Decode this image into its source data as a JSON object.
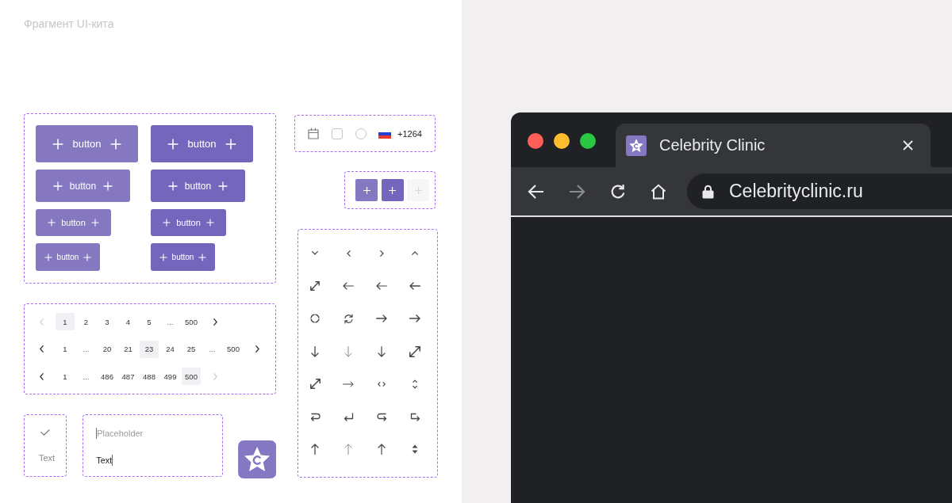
{
  "title": "Фрагмент UI-кита",
  "button_rows": [
    {
      "buttons": [
        {
          "label": "button",
          "kind": "light"
        },
        {
          "label": "button",
          "kind": "dark"
        }
      ]
    },
    {
      "buttons": [
        {
          "label": "button",
          "kind": "light"
        },
        {
          "label": "button",
          "kind": "dark"
        }
      ]
    },
    {
      "buttons": [
        {
          "label": "button",
          "kind": "light"
        },
        {
          "label": "button",
          "kind": "dark"
        }
      ]
    },
    {
      "buttons": [
        {
          "label": "button",
          "kind": "light"
        },
        {
          "label": "button",
          "kind": "dark"
        }
      ]
    }
  ],
  "controls": {
    "checkbox": {
      "checked": false
    },
    "radio": {
      "selected": false
    },
    "phone_code": "+1264"
  },
  "icon_buttons": [
    {
      "kind": "light",
      "disabled": false
    },
    {
      "kind": "dark",
      "disabled": false
    },
    {
      "kind": "light",
      "disabled": true
    }
  ],
  "paginations": [
    {
      "prev_disabled": true,
      "next_disabled": false,
      "pages": [
        {
          "kind": "page",
          "label": "1",
          "selected": true
        },
        {
          "kind": "page",
          "label": "2",
          "selected": false
        },
        {
          "kind": "page",
          "label": "3",
          "selected": false
        },
        {
          "kind": "page",
          "label": "4",
          "selected": false
        },
        {
          "kind": "page",
          "label": "5",
          "selected": false
        },
        {
          "kind": "gap",
          "label": "...",
          "selected": false
        },
        {
          "kind": "page",
          "label": "500",
          "selected": false
        }
      ]
    },
    {
      "prev_disabled": false,
      "next_disabled": false,
      "pages": [
        {
          "kind": "page",
          "label": "1",
          "selected": false
        },
        {
          "kind": "gap",
          "label": "...",
          "selected": false
        },
        {
          "kind": "page",
          "label": "20",
          "selected": false
        },
        {
          "kind": "page",
          "label": "21",
          "selected": false
        },
        {
          "kind": "page",
          "label": "23",
          "selected": true
        },
        {
          "kind": "page",
          "label": "24",
          "selected": false
        },
        {
          "kind": "page",
          "label": "25",
          "selected": false
        },
        {
          "kind": "gap",
          "label": "...",
          "selected": false
        },
        {
          "kind": "page",
          "label": "500",
          "selected": false
        }
      ]
    },
    {
      "prev_disabled": false,
      "next_disabled": true,
      "pages": [
        {
          "kind": "page",
          "label": "1",
          "selected": false
        },
        {
          "kind": "gap",
          "label": "...",
          "selected": false
        },
        {
          "kind": "page",
          "label": "486",
          "selected": false
        },
        {
          "kind": "page",
          "label": "487",
          "selected": false
        },
        {
          "kind": "page",
          "label": "488",
          "selected": false
        },
        {
          "kind": "page",
          "label": "499",
          "selected": false
        },
        {
          "kind": "page",
          "label": "500",
          "selected": true
        }
      ]
    }
  ],
  "check_option": {
    "checked": true,
    "label": "Text"
  },
  "inputs": [
    {
      "placeholder": "Placeholder",
      "focused": true
    },
    {
      "value": "Text",
      "focused": true
    }
  ],
  "browser": {
    "window_controls": [
      {
        "color": "#ff5f57"
      },
      {
        "color": "#febc2e"
      },
      {
        "color": "#28c840"
      }
    ],
    "tabs": [
      {
        "title": "Celebrity Clinic",
        "selected": true
      }
    ],
    "toolbar_buttons": [
      {
        "kind": "back",
        "disabled": false
      },
      {
        "kind": "forward",
        "disabled": true
      },
      {
        "kind": "reload",
        "disabled": false
      },
      {
        "kind": "home",
        "disabled": false
      }
    ],
    "address": "Celebrityclinic.ru"
  }
}
